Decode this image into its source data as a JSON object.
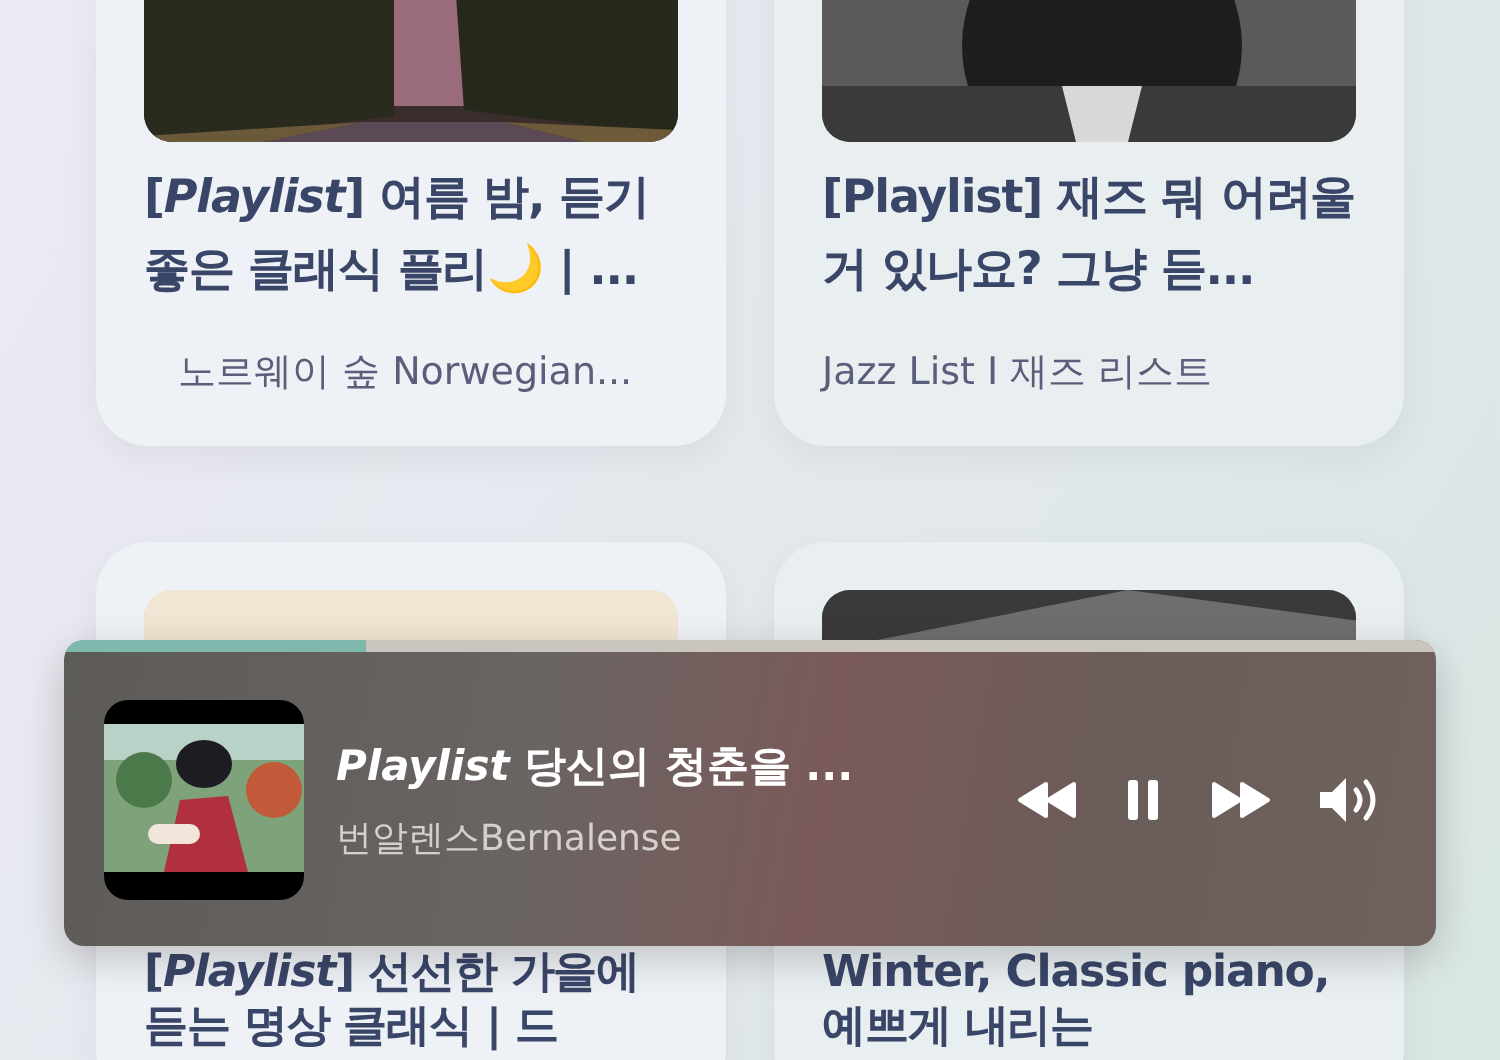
{
  "cards": [
    {
      "title": "[*Playlist*] 여름 밤, 듣기 좋은 클래식 플리🌙 | ...",
      "channel": "노르웨이 숲 Norwegian..."
    },
    {
      "title": "[Playlist] 재즈 뭐 어려울 거 있나요? 그냥 듣...",
      "channel": "Jazz List I 재즈 리스트"
    },
    {
      "title": "[*Playlist*] 선선한 가을에 듣는 명상 클래식 | 드"
    },
    {
      "title": "Winter, Classic piano, 예쁘게 내리는"
    }
  ],
  "player": {
    "title": "*Playlist* 당신의 청춘을 ...",
    "artist": "번알렌스Bernalense",
    "level": 0.22,
    "playing": true
  }
}
